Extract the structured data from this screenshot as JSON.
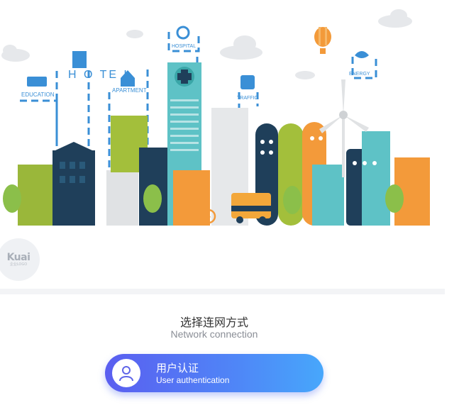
{
  "banner": {
    "labels": {
      "education": "EDUCATION",
      "hotel": "H O TE L",
      "apartment": "APARTMENT",
      "hospital": "HOSPITAL",
      "traffic": "TRAFFIC",
      "energy": "ENERGY"
    }
  },
  "logo": {
    "main": "Kuai",
    "sub": "企业LOGO"
  },
  "heading": {
    "zh": "选择连网方式",
    "en": "Network connection"
  },
  "auth_button": {
    "zh": "用户认证",
    "en": "User authentication",
    "icon": "user-icon"
  },
  "colors": {
    "button_start": "#5a5ef0",
    "button_end": "#47a7fb",
    "label_blue": "#3a8fd6"
  }
}
